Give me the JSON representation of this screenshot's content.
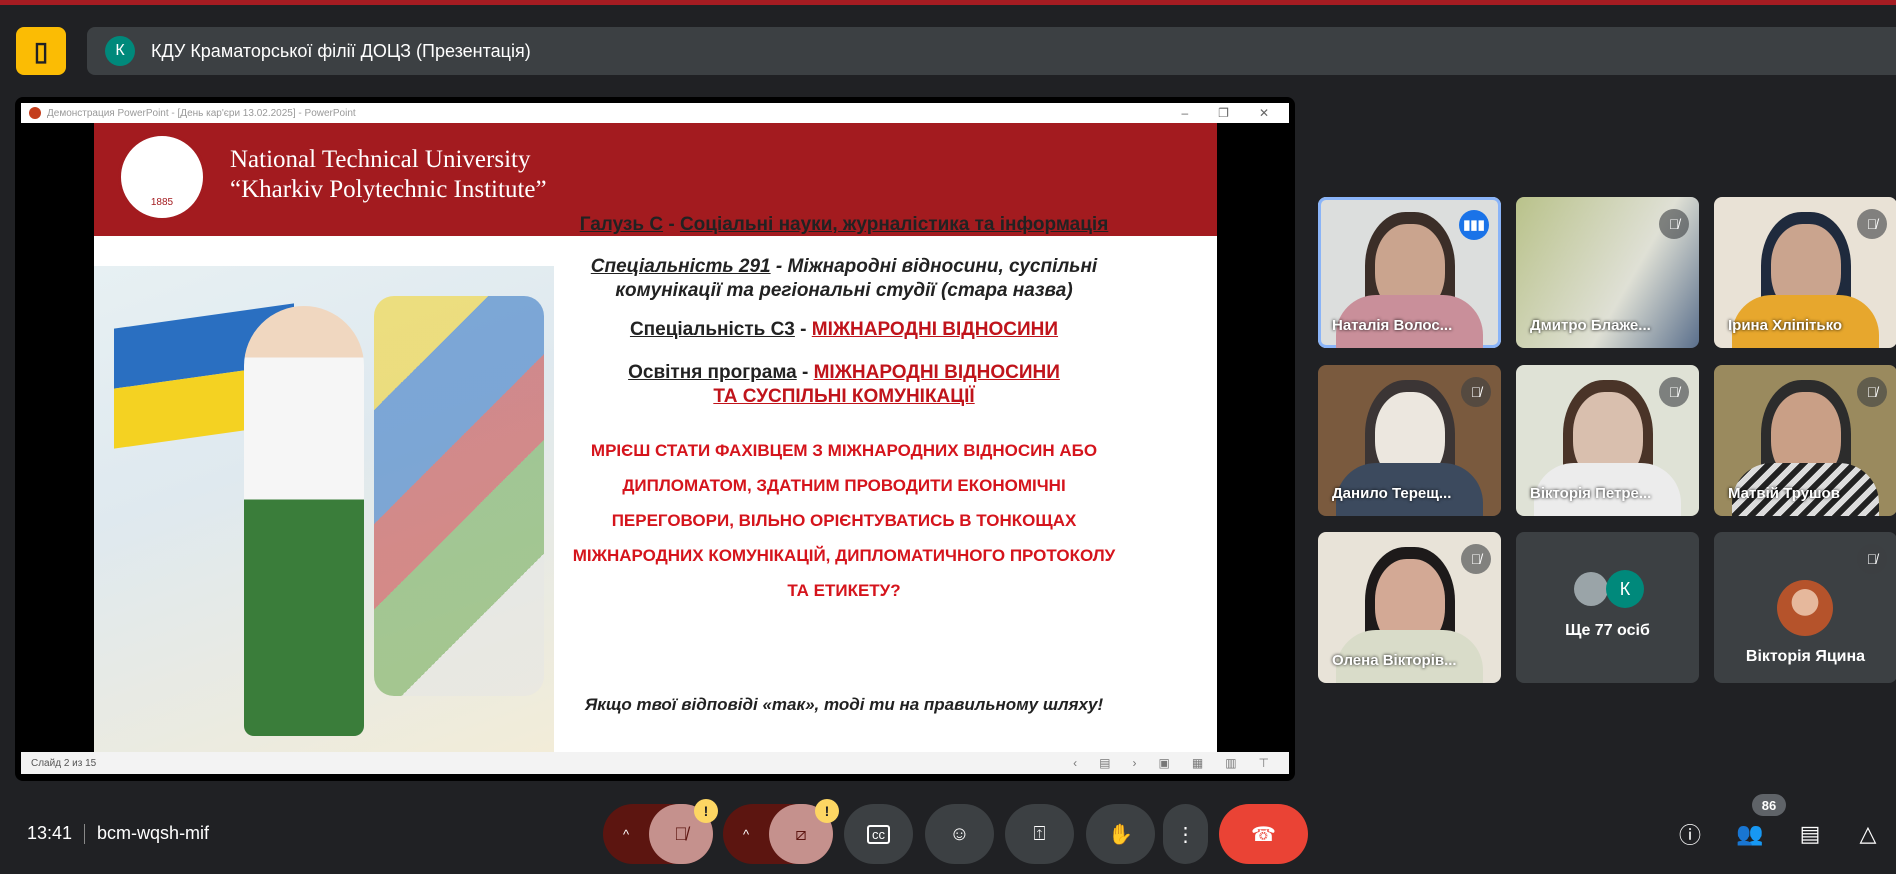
{
  "meeting": {
    "title": "КДУ Краматорської філії ДОЦЗ (Презентація)",
    "avatar_letter": "К",
    "time": "13:41",
    "code": "bcm-wqsh-mif",
    "participants_count": "86"
  },
  "ppt": {
    "window_title": "Демонстрация PowerPoint - [День кар'єри 13.02.2025] - PowerPoint",
    "status": "Слайд 2 из 15"
  },
  "slide": {
    "university": [
      "National Technical University",
      "“Kharkiv Polytechnic Institute”"
    ],
    "seal_year": "1885",
    "field_label": "Галузь С",
    "field_value": "Соціальні науки, журналістика та інформація",
    "spec_old_label": "Спеціальність 291",
    "spec_old_value": "Міжнародні відносини, суспільні комунікації та регіональні студії (стара назва)",
    "spec_label": "Спеціальність С3",
    "spec_value": "МІЖНАРОДНІ ВІДНОСИНИ",
    "program_label": "Освітня програма",
    "program_value": "МІЖНАРОДНІ ВІДНОСИНИ ТА СУСПІЛЬНІ КОМУНІКАЦІЇ",
    "dash": " - ",
    "question": [
      "МРІЄШ СТАТИ ФАХІВЦЕМ З МІЖНАРОДНИХ ВІДНОСИН АБО",
      "ДИПЛОМАТОМ, ЗДАТНИМ ПРОВОДИТИ ЕКОНОМІЧНІ",
      "ПЕРЕГОВОРИ, ВІЛЬНО ОРІЄНТУВАТИСЬ В ТОНКОЩАХ",
      "МІЖНАРОДНИХ КОМУНІКАЦІЙ, ДИПЛОМАТИЧНОГО ПРОТОКОЛУ",
      "ТА ЕТИКЕТУ?"
    ],
    "closing": "Якщо твої відповіді «так», тоді ти на правильному шляху!"
  },
  "participants": [
    {
      "name": "Наталія Волос...",
      "speaking": true
    },
    {
      "name": "Дмитро Блаже...",
      "muted": true
    },
    {
      "name": "Ірина Хліпітько",
      "muted": true
    },
    {
      "name": "Данило Терещ...",
      "muted": true
    },
    {
      "name": "Вікторія Петре...",
      "muted": true
    },
    {
      "name": "Матвій Трушов",
      "muted": true
    },
    {
      "name": "Олена Вікторів...",
      "muted": true
    },
    {
      "name": "Ще 77 осіб",
      "avatar_letter": "К"
    },
    {
      "name": "Вікторія Яцина",
      "muted": true
    }
  ],
  "controls": {
    "caret": "^",
    "warn": "!"
  },
  "colors": {
    "accent": "#1a73e8",
    "end_call": "#ea4335",
    "brand_red": "#a51c22"
  }
}
